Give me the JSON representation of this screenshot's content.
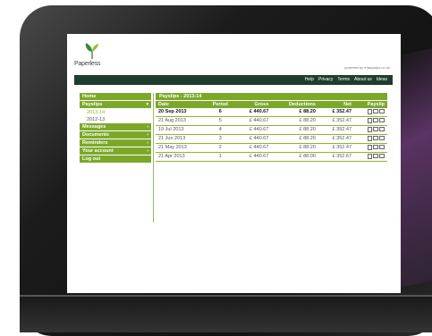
{
  "logo": {
    "text": "Paperless"
  },
  "powered_by": "powered by e*payslips.co.uk",
  "nav": [
    "Help",
    "Privacy",
    "Terms",
    "About us",
    "Ideas"
  ],
  "sidebar": {
    "items": [
      {
        "label": "Home",
        "arrow": ""
      },
      {
        "label": "Payslips",
        "arrow": "▾"
      }
    ],
    "sub_items": [
      "2013-14",
      "2012-13"
    ],
    "items_after": [
      {
        "label": "Messages",
        "arrow": "›"
      },
      {
        "label": "Documents",
        "arrow": "›"
      },
      {
        "label": "Reminders",
        "arrow": "›"
      },
      {
        "label": "Your account",
        "arrow": "›"
      },
      {
        "label": "Log out",
        "arrow": ""
      }
    ]
  },
  "content": {
    "title": "Payslips - 2013-14",
    "columns": [
      "Date",
      "Period",
      "Gross",
      "Deductions",
      "Net",
      "Payslip"
    ],
    "rows": [
      [
        "20 Sep 2013",
        "6",
        "£ 440.67",
        "£ 88.20",
        "£ 352.47"
      ],
      [
        "21 Aug 2013",
        "5",
        "£ 440.67",
        "£ 88.20",
        "£ 352.47"
      ],
      [
        "19 Jul 2013",
        "4",
        "£ 440.67",
        "£ 88.20",
        "£ 352.47"
      ],
      [
        "21 Jun 2013",
        "3",
        "£ 440.67",
        "£ 88.20",
        "£ 352.47"
      ],
      [
        "21 May 2013",
        "2",
        "£ 440.67",
        "£ 88.20",
        "£ 352.47"
      ],
      [
        "21 Apr 2013",
        "1",
        "£ 440.67",
        "£ 88.00",
        "£ 352.67"
      ]
    ]
  },
  "colors": {
    "accent": "#7ca82a",
    "nav_bg": "#1f3d2c",
    "text": "#555555"
  }
}
